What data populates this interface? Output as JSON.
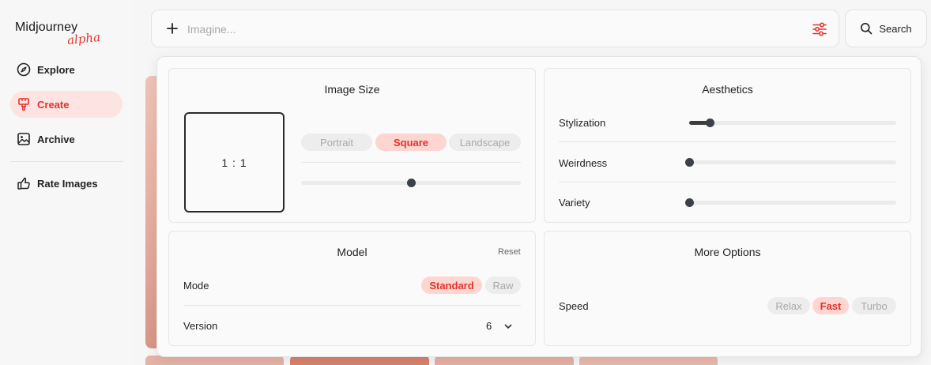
{
  "brand": {
    "name": "Midjourney",
    "tag": "alpha"
  },
  "sidebar": {
    "items": [
      {
        "label": "Explore",
        "icon": "compass-icon"
      },
      {
        "label": "Create",
        "icon": "brush-icon",
        "active": true
      },
      {
        "label": "Archive",
        "icon": "image-icon"
      },
      {
        "label": "Rate Images",
        "icon": "thumbs-up-icon"
      }
    ]
  },
  "imagine": {
    "placeholder": "Imagine...",
    "value": ""
  },
  "search": {
    "label": "Search"
  },
  "colors": {
    "accent": "#e3332a",
    "accent_bg": "#fdd6d1",
    "active_nav_bg": "#fde3e1"
  },
  "image_size": {
    "title": "Image Size",
    "ratio": "1 : 1",
    "options": [
      "Portrait",
      "Square",
      "Landscape"
    ],
    "selected": "Square",
    "slider_fraction": 0.5
  },
  "aesthetics": {
    "title": "Aesthetics",
    "sliders": [
      {
        "label": "Stylization",
        "fraction": 0.1
      },
      {
        "label": "Weirdness",
        "fraction": 0.0
      },
      {
        "label": "Variety",
        "fraction": 0.0
      }
    ]
  },
  "model": {
    "title": "Model",
    "reset_label": "Reset",
    "mode_label": "Mode",
    "mode_options": [
      "Standard",
      "Raw"
    ],
    "mode_selected": "Standard",
    "version_label": "Version",
    "version_value": "6"
  },
  "more_options": {
    "title": "More Options",
    "speed_label": "Speed",
    "speed_options": [
      "Relax",
      "Fast",
      "Turbo"
    ],
    "speed_selected": "Fast"
  }
}
